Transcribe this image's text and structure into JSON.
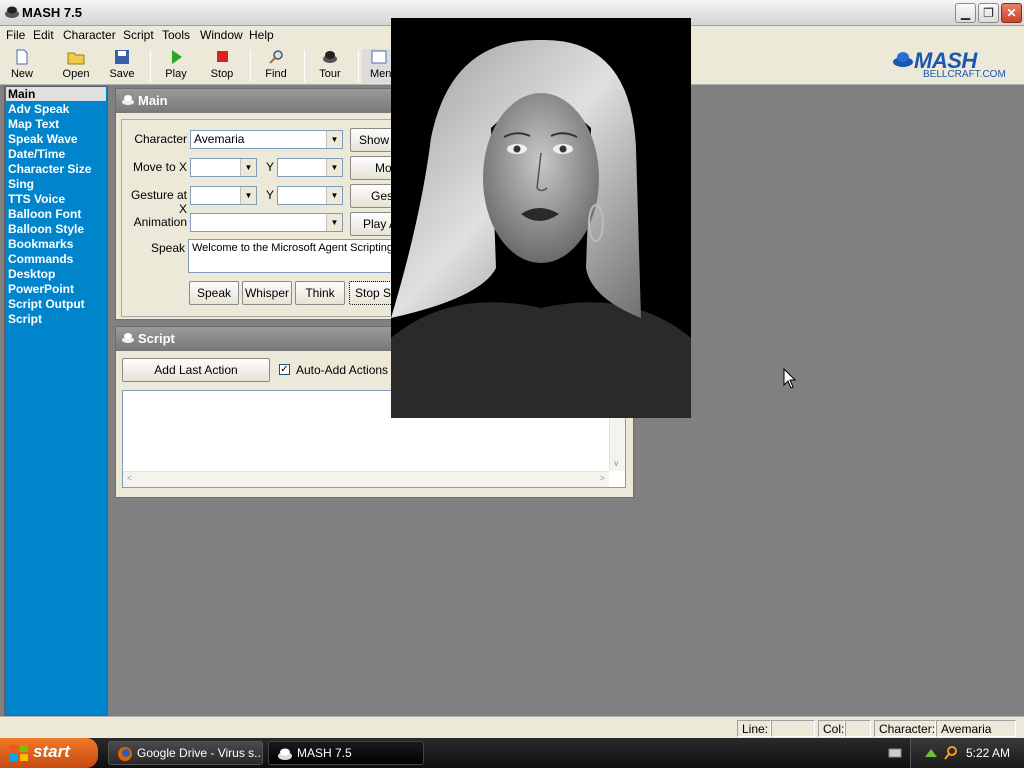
{
  "window": {
    "title": "MASH 7.5"
  },
  "menu": [
    "File",
    "Edit",
    "Character",
    "Script",
    "Tools",
    "Window",
    "Help"
  ],
  "toolbar": {
    "buttons": [
      {
        "label": "New",
        "icon": "new-document-icon"
      },
      {
        "label": "Open",
        "icon": "open-folder-icon"
      },
      {
        "label": "Save",
        "icon": "floppy-disk-icon"
      },
      {
        "label": "Play",
        "icon": "play-icon"
      },
      {
        "label": "Stop",
        "icon": "stop-icon"
      },
      {
        "label": "Find",
        "icon": "magnifier-icon"
      },
      {
        "label": "Tour",
        "icon": "tour-icon"
      },
      {
        "label": "Men",
        "icon": "menu-icon"
      }
    ]
  },
  "logo": {
    "word": "MASH",
    "sub": "BELLCRAFT.COM"
  },
  "sidebar": {
    "items": [
      "Main",
      "Adv Speak",
      "Map Text",
      "Speak Wave",
      "Date/Time",
      "Character Size",
      "Sing",
      "TTS Voice",
      "Balloon Font",
      "Balloon Style",
      "Bookmarks",
      "Commands",
      "Desktop",
      "PowerPoint",
      "Script Output",
      "Script"
    ],
    "active": "Main"
  },
  "main_panel": {
    "title": "Main",
    "character_label": "Character",
    "character_value": "Avemaria",
    "show_button": "Show",
    "moveto_label": "Move to X",
    "moveto_y_label": "Y",
    "move_button": "Mo",
    "gesture_label": "Gesture at X",
    "gesture_y_label": "Y",
    "gesture_button": "Ges",
    "animation_label": "Animation",
    "play_button": "Play A",
    "speak_label": "Speak",
    "speak_text": "Welcome to the Microsoft Agent Scripting",
    "speak_button": "Speak",
    "whisper_button": "Whisper",
    "think_button": "Think",
    "stop_speaking_button": "Stop Sp"
  },
  "script_panel": {
    "title": "Script",
    "add_last_action": "Add Last Action",
    "auto_add_label": "Auto-Add Actions to",
    "auto_add_checked": true
  },
  "statusbar": {
    "line_label": "Line:",
    "line_value": "",
    "col_label": "Col:",
    "col_value": "",
    "character_label": "Character:",
    "character_value": "Avemaria"
  },
  "taskbar": {
    "start_label": "start",
    "tasks": [
      "Google Drive - Virus s...",
      "MASH 7.5"
    ],
    "clock": "5:22 AM"
  },
  "colors": {
    "sidebar_bg": "#0085cc",
    "start_button": "#e06020",
    "logo_blue": "#1b57b0"
  }
}
